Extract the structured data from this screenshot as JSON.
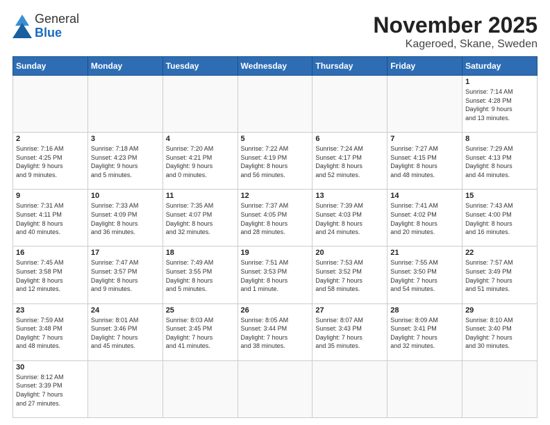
{
  "header": {
    "logo_line1": "General",
    "logo_line2": "Blue",
    "title": "November 2025",
    "subtitle": "Kageroed, Skane, Sweden"
  },
  "weekdays": [
    "Sunday",
    "Monday",
    "Tuesday",
    "Wednesday",
    "Thursday",
    "Friday",
    "Saturday"
  ],
  "weeks": [
    [
      {
        "day": "",
        "info": ""
      },
      {
        "day": "",
        "info": ""
      },
      {
        "day": "",
        "info": ""
      },
      {
        "day": "",
        "info": ""
      },
      {
        "day": "",
        "info": ""
      },
      {
        "day": "",
        "info": ""
      },
      {
        "day": "1",
        "info": "Sunrise: 7:14 AM\nSunset: 4:28 PM\nDaylight: 9 hours\nand 13 minutes."
      }
    ],
    [
      {
        "day": "2",
        "info": "Sunrise: 7:16 AM\nSunset: 4:25 PM\nDaylight: 9 hours\nand 9 minutes."
      },
      {
        "day": "3",
        "info": "Sunrise: 7:18 AM\nSunset: 4:23 PM\nDaylight: 9 hours\nand 5 minutes."
      },
      {
        "day": "4",
        "info": "Sunrise: 7:20 AM\nSunset: 4:21 PM\nDaylight: 9 hours\nand 0 minutes."
      },
      {
        "day": "5",
        "info": "Sunrise: 7:22 AM\nSunset: 4:19 PM\nDaylight: 8 hours\nand 56 minutes."
      },
      {
        "day": "6",
        "info": "Sunrise: 7:24 AM\nSunset: 4:17 PM\nDaylight: 8 hours\nand 52 minutes."
      },
      {
        "day": "7",
        "info": "Sunrise: 7:27 AM\nSunset: 4:15 PM\nDaylight: 8 hours\nand 48 minutes."
      },
      {
        "day": "8",
        "info": "Sunrise: 7:29 AM\nSunset: 4:13 PM\nDaylight: 8 hours\nand 44 minutes."
      }
    ],
    [
      {
        "day": "9",
        "info": "Sunrise: 7:31 AM\nSunset: 4:11 PM\nDaylight: 8 hours\nand 40 minutes."
      },
      {
        "day": "10",
        "info": "Sunrise: 7:33 AM\nSunset: 4:09 PM\nDaylight: 8 hours\nand 36 minutes."
      },
      {
        "day": "11",
        "info": "Sunrise: 7:35 AM\nSunset: 4:07 PM\nDaylight: 8 hours\nand 32 minutes."
      },
      {
        "day": "12",
        "info": "Sunrise: 7:37 AM\nSunset: 4:05 PM\nDaylight: 8 hours\nand 28 minutes."
      },
      {
        "day": "13",
        "info": "Sunrise: 7:39 AM\nSunset: 4:03 PM\nDaylight: 8 hours\nand 24 minutes."
      },
      {
        "day": "14",
        "info": "Sunrise: 7:41 AM\nSunset: 4:02 PM\nDaylight: 8 hours\nand 20 minutes."
      },
      {
        "day": "15",
        "info": "Sunrise: 7:43 AM\nSunset: 4:00 PM\nDaylight: 8 hours\nand 16 minutes."
      }
    ],
    [
      {
        "day": "16",
        "info": "Sunrise: 7:45 AM\nSunset: 3:58 PM\nDaylight: 8 hours\nand 12 minutes."
      },
      {
        "day": "17",
        "info": "Sunrise: 7:47 AM\nSunset: 3:57 PM\nDaylight: 8 hours\nand 9 minutes."
      },
      {
        "day": "18",
        "info": "Sunrise: 7:49 AM\nSunset: 3:55 PM\nDaylight: 8 hours\nand 5 minutes."
      },
      {
        "day": "19",
        "info": "Sunrise: 7:51 AM\nSunset: 3:53 PM\nDaylight: 8 hours\nand 1 minute."
      },
      {
        "day": "20",
        "info": "Sunrise: 7:53 AM\nSunset: 3:52 PM\nDaylight: 7 hours\nand 58 minutes."
      },
      {
        "day": "21",
        "info": "Sunrise: 7:55 AM\nSunset: 3:50 PM\nDaylight: 7 hours\nand 54 minutes."
      },
      {
        "day": "22",
        "info": "Sunrise: 7:57 AM\nSunset: 3:49 PM\nDaylight: 7 hours\nand 51 minutes."
      }
    ],
    [
      {
        "day": "23",
        "info": "Sunrise: 7:59 AM\nSunset: 3:48 PM\nDaylight: 7 hours\nand 48 minutes."
      },
      {
        "day": "24",
        "info": "Sunrise: 8:01 AM\nSunset: 3:46 PM\nDaylight: 7 hours\nand 45 minutes."
      },
      {
        "day": "25",
        "info": "Sunrise: 8:03 AM\nSunset: 3:45 PM\nDaylight: 7 hours\nand 41 minutes."
      },
      {
        "day": "26",
        "info": "Sunrise: 8:05 AM\nSunset: 3:44 PM\nDaylight: 7 hours\nand 38 minutes."
      },
      {
        "day": "27",
        "info": "Sunrise: 8:07 AM\nSunset: 3:43 PM\nDaylight: 7 hours\nand 35 minutes."
      },
      {
        "day": "28",
        "info": "Sunrise: 8:09 AM\nSunset: 3:41 PM\nDaylight: 7 hours\nand 32 minutes."
      },
      {
        "day": "29",
        "info": "Sunrise: 8:10 AM\nSunset: 3:40 PM\nDaylight: 7 hours\nand 30 minutes."
      }
    ],
    [
      {
        "day": "30",
        "info": "Sunrise: 8:12 AM\nSunset: 3:39 PM\nDaylight: 7 hours\nand 27 minutes."
      },
      {
        "day": "",
        "info": ""
      },
      {
        "day": "",
        "info": ""
      },
      {
        "day": "",
        "info": ""
      },
      {
        "day": "",
        "info": ""
      },
      {
        "day": "",
        "info": ""
      },
      {
        "day": "",
        "info": ""
      }
    ]
  ]
}
